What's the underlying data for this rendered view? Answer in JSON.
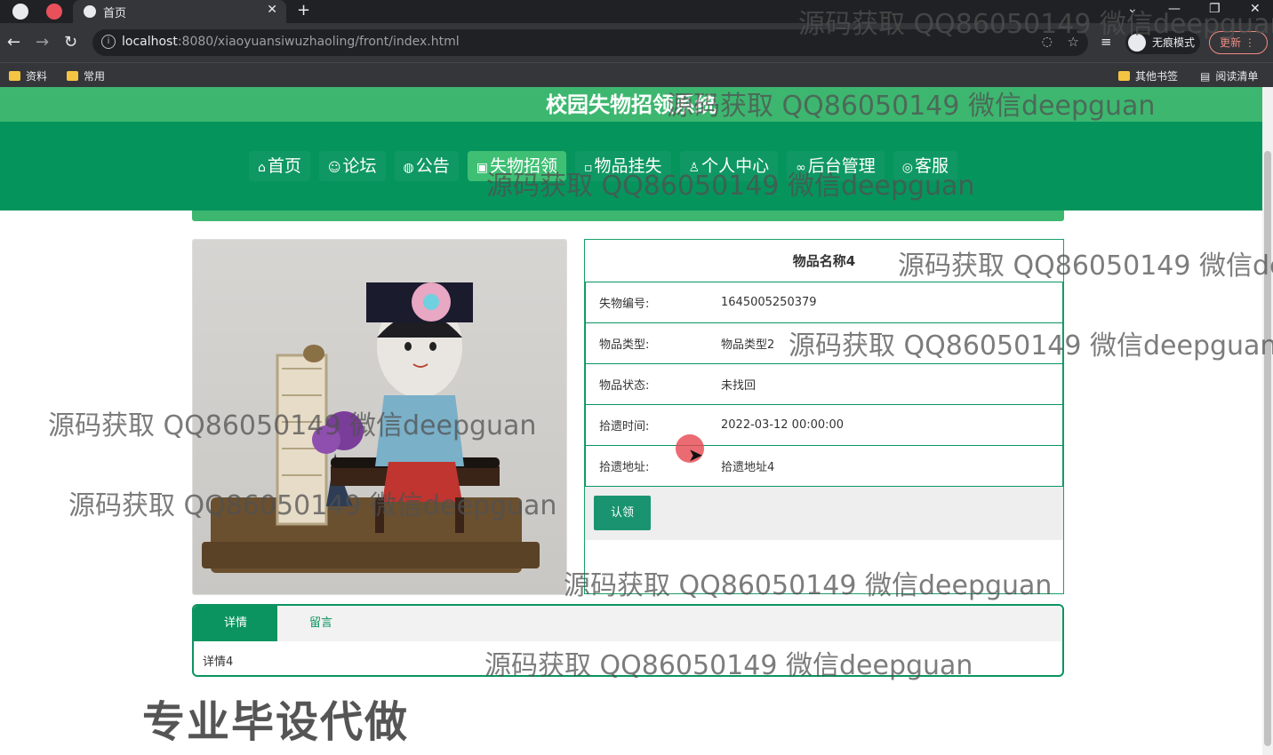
{
  "browser": {
    "tab_title": "首页",
    "url_host": "localhost",
    "url_rest": ":8080/xiaoyuansiwuzhaoling/front/index.html",
    "incognito_label": "无痕模式",
    "update_label": "更新",
    "bookmarks": [
      "资料",
      "常用"
    ],
    "bookmarks_right": [
      "其他书签",
      "阅读清单"
    ]
  },
  "site": {
    "title": "校园失物招领系统",
    "nav": [
      {
        "icon": "⌂",
        "label": "首页"
      },
      {
        "icon": "☺",
        "label": "论坛"
      },
      {
        "icon": "◍",
        "label": "公告"
      },
      {
        "icon": "▣",
        "label": "失物招领"
      },
      {
        "icon": "▫",
        "label": "物品挂失"
      },
      {
        "icon": "♙",
        "label": "个人中心"
      },
      {
        "icon": "∞",
        "label": "后台管理"
      },
      {
        "icon": "◎",
        "label": "客服"
      }
    ]
  },
  "item": {
    "name": "物品名称4",
    "rows": [
      {
        "label": "失物编号:",
        "value": "1645005250379"
      },
      {
        "label": "物品类型:",
        "value": "物品类型2"
      },
      {
        "label": "物品状态:",
        "value": "未找回"
      },
      {
        "label": "拾遗时间:",
        "value": "2022-03-12 00:00:00"
      },
      {
        "label": "拾遗地址:",
        "value": "拾遗地址4"
      }
    ],
    "claim_label": "认领"
  },
  "tabs": {
    "detail_label": "详情",
    "comment_label": "留言",
    "body": "详情4"
  },
  "watermarks": {
    "text": "源码获取 QQ86050149 微信deepguan",
    "big": "专业毕设代做"
  }
}
